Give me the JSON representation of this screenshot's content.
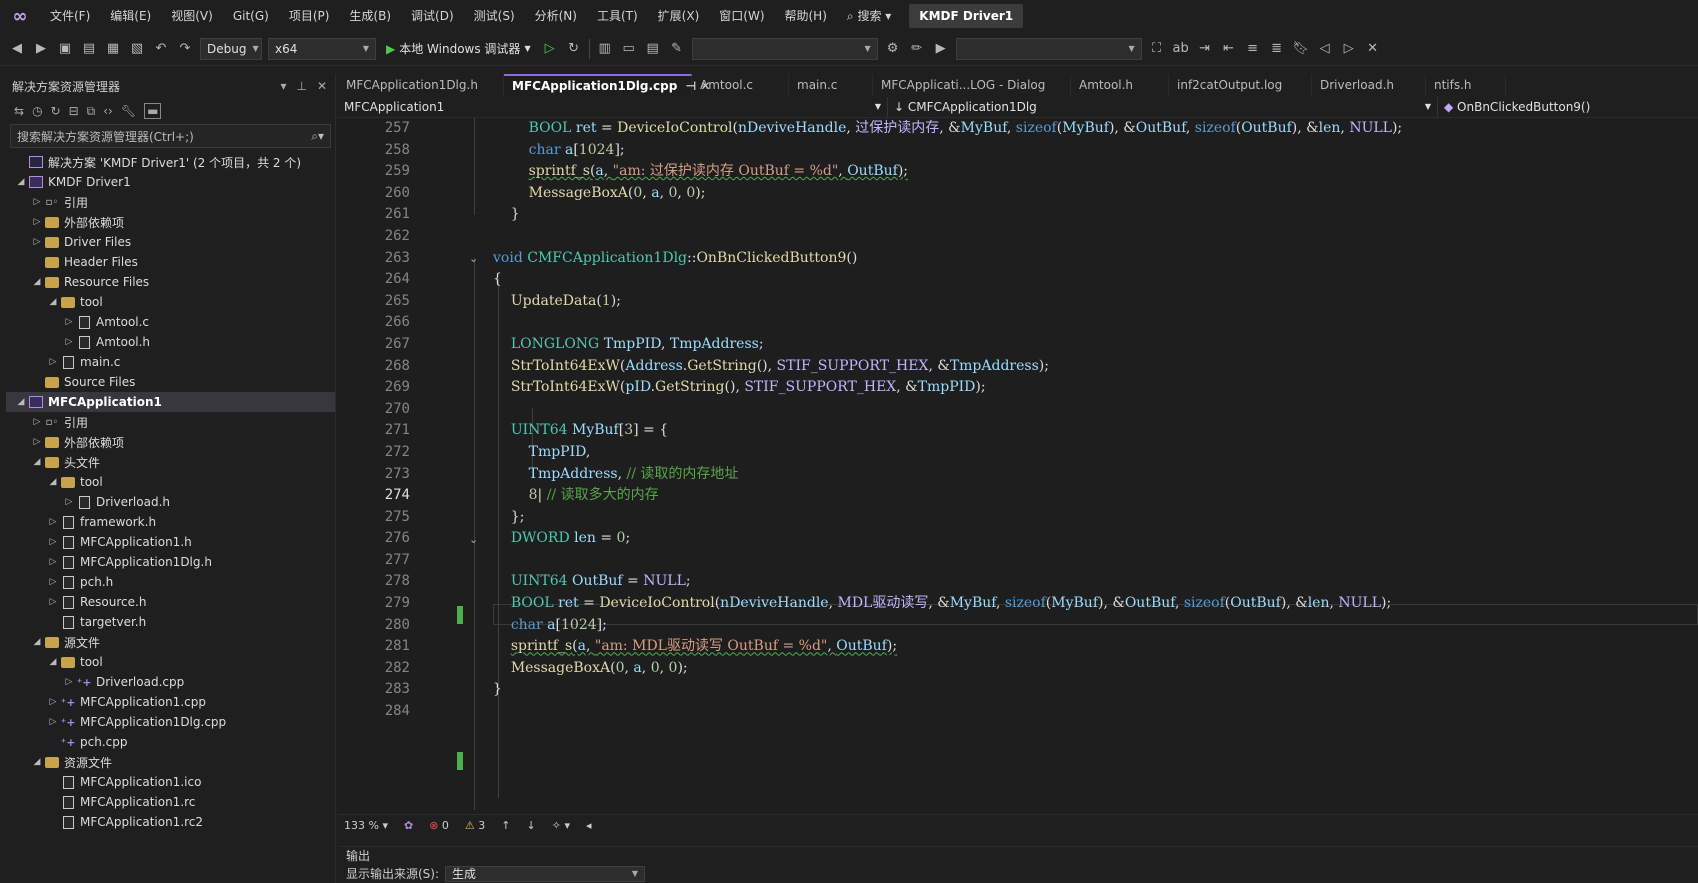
{
  "menubar": {
    "items": [
      "文件(F)",
      "编辑(E)",
      "视图(V)",
      "Git(G)",
      "项目(P)",
      "生成(B)",
      "调试(D)",
      "测试(S)",
      "分析(N)",
      "工具(T)",
      "扩展(X)",
      "窗口(W)",
      "帮助(H)"
    ],
    "search": "搜索",
    "solution_title": "KMDF Driver1"
  },
  "toolbar": {
    "config": "Debug",
    "platform": "x64",
    "run_label": "本地 Windows 调试器"
  },
  "solution_explorer": {
    "title": "解决方案资源管理器",
    "search_placeholder": "搜索解决方案资源管理器(Ctrl+;)",
    "items": [
      {
        "label": "解决方案 'KMDF Driver1' (2 个项目，共 2 个)",
        "indent": 0,
        "exp": "",
        "icon": "sol"
      },
      {
        "label": "KMDF Driver1",
        "indent": 0,
        "exp": "◢",
        "icon": "proj"
      },
      {
        "label": "引用",
        "indent": 1,
        "exp": "▷",
        "icon": "ref"
      },
      {
        "label": "外部依赖项",
        "indent": 1,
        "exp": "▷",
        "icon": "folder"
      },
      {
        "label": "Driver Files",
        "indent": 1,
        "exp": "▷",
        "icon": "folder"
      },
      {
        "label": "Header Files",
        "indent": 1,
        "exp": "",
        "icon": "folder"
      },
      {
        "label": "Resource Files",
        "indent": 1,
        "exp": "◢",
        "icon": "folder"
      },
      {
        "label": "tool",
        "indent": 2,
        "exp": "◢",
        "icon": "folder"
      },
      {
        "label": "Amtool.c",
        "indent": 3,
        "exp": "▷",
        "icon": "file"
      },
      {
        "label": "Amtool.h",
        "indent": 3,
        "exp": "▷",
        "icon": "file"
      },
      {
        "label": "main.c",
        "indent": 2,
        "exp": "▷",
        "icon": "file"
      },
      {
        "label": "Source Files",
        "indent": 1,
        "exp": "",
        "icon": "folder"
      },
      {
        "label": "MFCApplication1",
        "indent": 0,
        "exp": "◢",
        "icon": "proj",
        "selected": true
      },
      {
        "label": "引用",
        "indent": 1,
        "exp": "▷",
        "icon": "ref"
      },
      {
        "label": "外部依赖项",
        "indent": 1,
        "exp": "▷",
        "icon": "folder"
      },
      {
        "label": "头文件",
        "indent": 1,
        "exp": "◢",
        "icon": "folder"
      },
      {
        "label": "tool",
        "indent": 2,
        "exp": "◢",
        "icon": "folder"
      },
      {
        "label": "Driverload.h",
        "indent": 3,
        "exp": "▷",
        "icon": "file"
      },
      {
        "label": "framework.h",
        "indent": 2,
        "exp": "▷",
        "icon": "file"
      },
      {
        "label": "MFCApplication1.h",
        "indent": 2,
        "exp": "▷",
        "icon": "file"
      },
      {
        "label": "MFCApplication1Dlg.h",
        "indent": 2,
        "exp": "▷",
        "icon": "file"
      },
      {
        "label": "pch.h",
        "indent": 2,
        "exp": "▷",
        "icon": "file"
      },
      {
        "label": "Resource.h",
        "indent": 2,
        "exp": "▷",
        "icon": "file"
      },
      {
        "label": "targetver.h",
        "indent": 2,
        "exp": "",
        "icon": "file"
      },
      {
        "label": "源文件",
        "indent": 1,
        "exp": "◢",
        "icon": "folder"
      },
      {
        "label": "tool",
        "indent": 2,
        "exp": "◢",
        "icon": "folder"
      },
      {
        "label": "Driverload.cpp",
        "indent": 3,
        "exp": "▷",
        "icon": "cpp"
      },
      {
        "label": "MFCApplication1.cpp",
        "indent": 2,
        "exp": "▷",
        "icon": "cpp"
      },
      {
        "label": "MFCApplication1Dlg.cpp",
        "indent": 2,
        "exp": "▷",
        "icon": "cpp"
      },
      {
        "label": "pch.cpp",
        "indent": 2,
        "exp": "",
        "icon": "cpp"
      },
      {
        "label": "资源文件",
        "indent": 1,
        "exp": "◢",
        "icon": "folder"
      },
      {
        "label": "MFCApplication1.ico",
        "indent": 2,
        "exp": "",
        "icon": "file"
      },
      {
        "label": "MFCApplication1.rc",
        "indent": 2,
        "exp": "",
        "icon": "file"
      },
      {
        "label": "MFCApplication1.rc2",
        "indent": 2,
        "exp": "",
        "icon": "file"
      }
    ]
  },
  "tabs": [
    {
      "label": "MFCApplication1Dlg.h",
      "active": false
    },
    {
      "label": "MFCApplication1Dlg.cpp",
      "active": true
    },
    {
      "label": "Amtool.c",
      "active": false
    },
    {
      "label": "main.c",
      "active": false
    },
    {
      "label": "MFCApplicati...LOG - Dialog",
      "active": false
    },
    {
      "label": "Amtool.h",
      "active": false
    },
    {
      "label": "inf2catOutput.log",
      "active": false
    },
    {
      "label": "Driverload.h",
      "active": false
    },
    {
      "label": "ntifs.h",
      "active": false
    }
  ],
  "navbar": {
    "project": "MFCApplication1",
    "class": "CMFCApplication1Dlg",
    "member": "OnBnClickedButton9()"
  },
  "editor": {
    "line_numbers": [
      257,
      258,
      259,
      260,
      261,
      262,
      263,
      264,
      265,
      266,
      267,
      268,
      269,
      270,
      271,
      272,
      273,
      274,
      275,
      276,
      277,
      278,
      279,
      280,
      281,
      282,
      283,
      284
    ],
    "current_line": 274
  },
  "status": {
    "zoom": "133 %",
    "errors": "0",
    "warnings": "3"
  },
  "output": {
    "title": "输出",
    "source_label": "显示输出来源(S):",
    "source_value": "生成"
  }
}
